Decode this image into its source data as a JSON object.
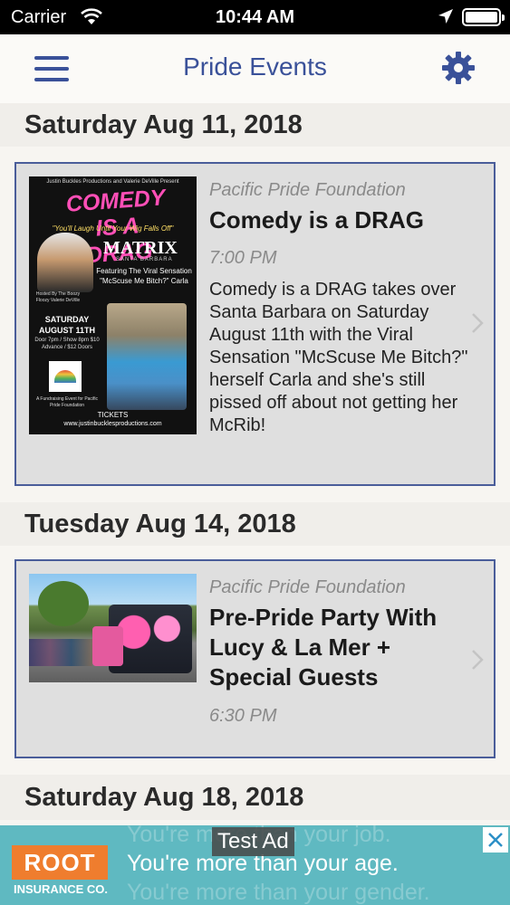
{
  "status_bar": {
    "carrier": "Carrier",
    "time": "10:44 AM"
  },
  "nav": {
    "title": "Pride Events",
    "accent_color": "#3a5199",
    "left_icon": "hamburger-menu-icon",
    "right_icon": "gear-icon"
  },
  "sections": [
    {
      "date": "Saturday Aug 11, 2018",
      "event": {
        "organizer": "Pacific Pride Foundation",
        "title": "Comedy is a DRAG",
        "time": "7:00 PM",
        "description": "Comedy is a DRAG takes over Santa Barbara on Saturday August 11th with the Viral Sensation \"McScuse Me Bitch?\" herself Carla and she's still pissed off about not getting her McRib!",
        "poster": {
          "presenters": "Justin Buckles Productions and Valerie DeVille Present",
          "headline": "COMEDY IS A DRAG",
          "tagline": "\"You'll Laugh Until Your Wig Falls Off\"",
          "venue": "MATRIX",
          "venue_sub": "SANTA BARBARA",
          "featuring": "Featuring The Viral Sensation \"McScuse Me Bitch?\" Carla",
          "hosts": "Hosted By The Boozy Floozy Valerie DeVille",
          "date": "SATURDAY AUGUST 11TH",
          "doors": "Door 7pm / Show 8pm $10 Advance / $12 Doors",
          "fundraiser": "A Fundraising Event for Pacific Pride Foundation",
          "tickets": "TICKETS",
          "url": "www.justinbucklesproductions.com"
        }
      }
    },
    {
      "date": "Tuesday Aug 14, 2018",
      "event": {
        "organizer": "Pacific Pride Foundation",
        "title": "Pre-Pride Party With Lucy & La Mer + Special Guests",
        "time": "6:30 PM"
      }
    },
    {
      "date": "Saturday Aug 18, 2018"
    }
  ],
  "ad": {
    "label": "Test Ad",
    "brand": "ROOT",
    "brand_sub": "INSURANCE CO.",
    "ghost_top": "You're more than your job.",
    "headline": "You're more than your age.",
    "ghost_bottom": "You're more than your gender.",
    "background": "#5fb9c1",
    "brand_color": "#ef7d2e"
  }
}
